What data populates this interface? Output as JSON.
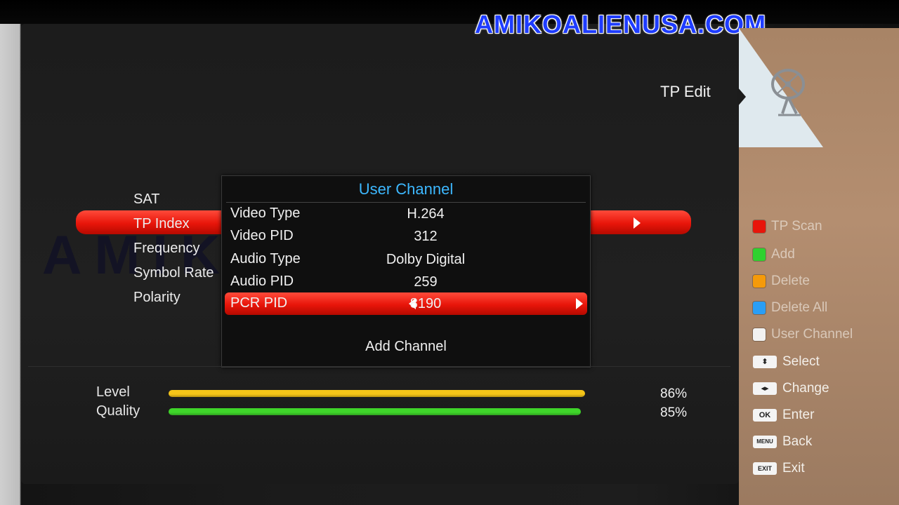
{
  "watermark": "AMIKOALIENUSA.COM",
  "page_title": "TP Edit",
  "settings": [
    {
      "label": "SAT"
    },
    {
      "label": "TP Index"
    },
    {
      "label": "Frequency"
    },
    {
      "label": "Symbol Rate"
    },
    {
      "label": "Polarity"
    }
  ],
  "dialog": {
    "title": "User Channel",
    "rows": [
      {
        "label": "Video Type",
        "value": "H.264"
      },
      {
        "label": "Video PID",
        "value": "312"
      },
      {
        "label": "Audio Type",
        "value": "Dolby Digital"
      },
      {
        "label": "Audio PID",
        "value": "259"
      },
      {
        "label": "PCR PID",
        "value": "8190"
      }
    ],
    "add_button": "Add Channel"
  },
  "meters": {
    "level": {
      "label": "Level",
      "value_text": "86%",
      "fraction": 0.86,
      "color": "#f5c518"
    },
    "quality": {
      "label": "Quality",
      "value_text": "85%",
      "fraction": 0.85,
      "color": "#3fd62a"
    }
  },
  "help": {
    "color_keys": [
      {
        "label": "TP Scan",
        "color": "#e8150a"
      },
      {
        "label": "Add",
        "color": "#2fd12f"
      },
      {
        "label": "Delete",
        "color": "#f59a0a"
      },
      {
        "label": "Delete All",
        "color": "#2a9ef5"
      },
      {
        "label": "User Channel",
        "color": "#f2f2f2"
      }
    ],
    "keys": [
      {
        "cap": "⬍",
        "label": "Select"
      },
      {
        "cap": "◂▸",
        "label": "Change"
      },
      {
        "cap": "OK",
        "label": "Enter"
      },
      {
        "cap": "MENU",
        "label": "Back"
      },
      {
        "cap": "EXIT",
        "label": "Exit"
      }
    ]
  }
}
